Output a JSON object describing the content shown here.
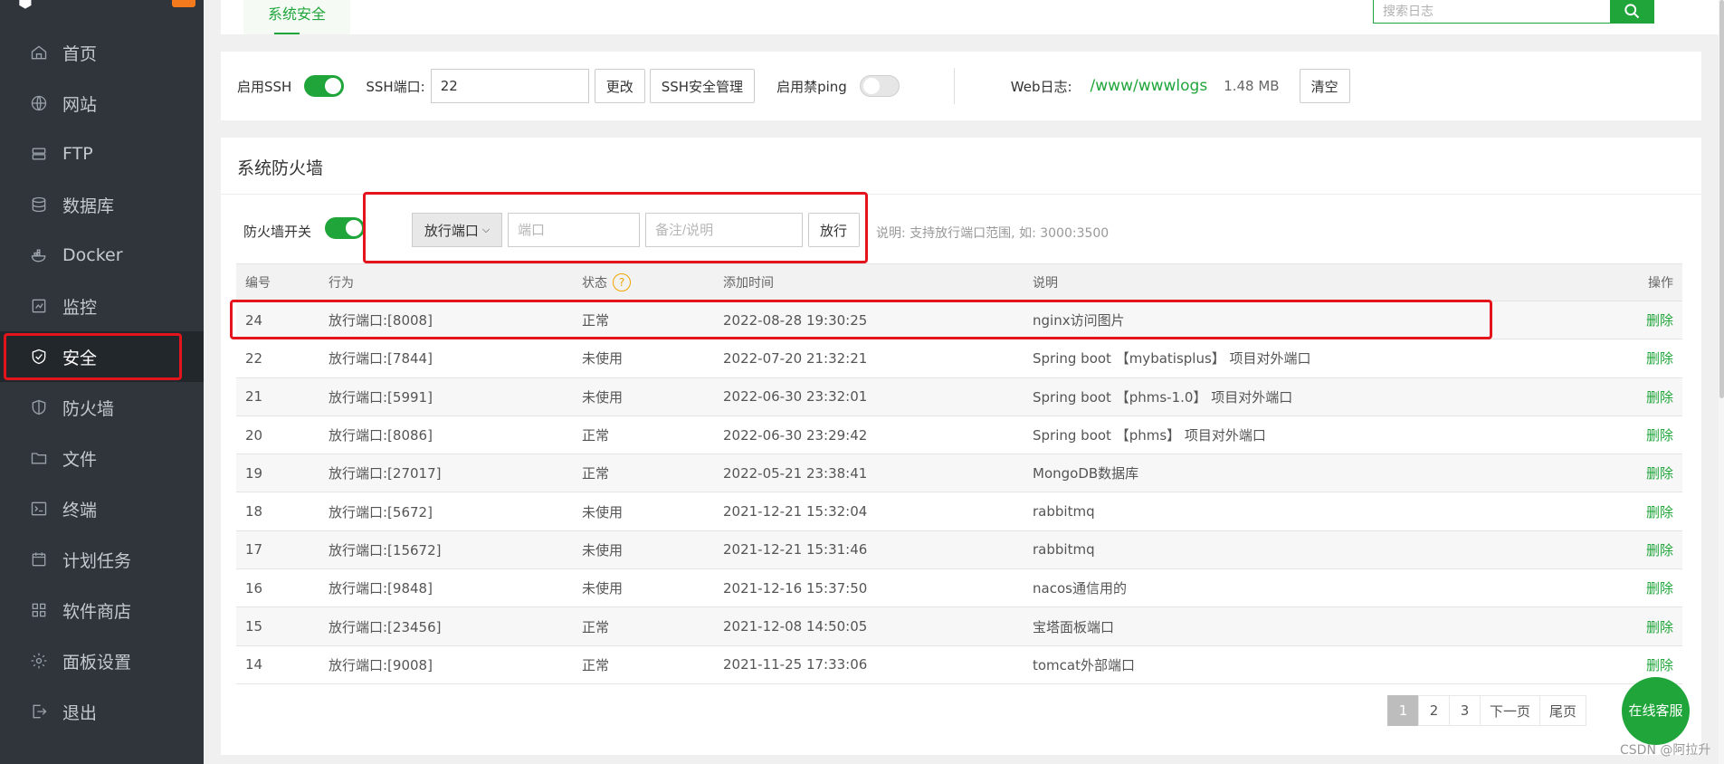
{
  "sidebar": {
    "items": [
      {
        "label": "首页",
        "icon": "home-icon"
      },
      {
        "label": "网站",
        "icon": "globe-icon"
      },
      {
        "label": "FTP",
        "icon": "ftp-icon"
      },
      {
        "label": "数据库",
        "icon": "database-icon"
      },
      {
        "label": "Docker",
        "icon": "docker-icon"
      },
      {
        "label": "监控",
        "icon": "monitor-icon"
      },
      {
        "label": "安全",
        "icon": "shield-check-icon",
        "active": true
      },
      {
        "label": "防火墙",
        "icon": "shield-icon"
      },
      {
        "label": "文件",
        "icon": "folder-icon"
      },
      {
        "label": "终端",
        "icon": "terminal-icon"
      },
      {
        "label": "计划任务",
        "icon": "calendar-icon"
      },
      {
        "label": "软件商店",
        "icon": "apps-icon"
      },
      {
        "label": "面板设置",
        "icon": "gear-icon"
      },
      {
        "label": "退出",
        "icon": "logout-icon"
      }
    ]
  },
  "tabs": {
    "active": "系统安全"
  },
  "log_search": {
    "placeholder": "搜索日志"
  },
  "ssh": {
    "enable_label": "启用SSH",
    "enabled": true,
    "port_label": "SSH端口:",
    "port_value": "22",
    "change_button": "更改",
    "manage_button": "SSH安全管理",
    "ping_label": "启用禁ping",
    "ping_enabled": false,
    "weblog_label": "Web日志:",
    "weblog_path": "/www/wwwlogs",
    "weblog_size": "1.48 MB",
    "clear_button": "清空"
  },
  "firewall": {
    "title": "系统防火墙",
    "switch_label": "防火墙开关",
    "switch_on": true,
    "select_value": "放行端口",
    "port_placeholder": "端口",
    "note_placeholder": "备注/说明",
    "allow_button": "放行",
    "hint": "说明: 支持放行端口范围, 如: 3000:3500",
    "columns": {
      "id": "编号",
      "action": "行为",
      "status": "状态",
      "time": "添加时间",
      "desc": "说明",
      "op": "操作"
    },
    "rows": [
      {
        "id": "24",
        "action": "放行端口:[8008]",
        "status": "正常",
        "time": "2022-08-28 19:30:25",
        "desc": "nginx访问图片",
        "op": "删除"
      },
      {
        "id": "22",
        "action": "放行端口:[7844]",
        "status": "未使用",
        "time": "2022-07-20 21:32:21",
        "desc": "Spring boot 【mybatisplus】 项目对外端口",
        "op": "删除"
      },
      {
        "id": "21",
        "action": "放行端口:[5991]",
        "status": "未使用",
        "time": "2022-06-30 23:32:01",
        "desc": "Spring boot 【phms-1.0】 项目对外端口",
        "op": "删除"
      },
      {
        "id": "20",
        "action": "放行端口:[8086]",
        "status": "正常",
        "time": "2022-06-30 23:29:42",
        "desc": "Spring boot 【phms】 项目对外端口",
        "op": "删除"
      },
      {
        "id": "19",
        "action": "放行端口:[27017]",
        "status": "正常",
        "time": "2022-05-21 23:38:41",
        "desc": "MongoDB数据库",
        "op": "删除"
      },
      {
        "id": "18",
        "action": "放行端口:[5672]",
        "status": "未使用",
        "time": "2021-12-21 15:32:04",
        "desc": "rabbitmq",
        "op": "删除"
      },
      {
        "id": "17",
        "action": "放行端口:[15672]",
        "status": "未使用",
        "time": "2021-12-21 15:31:46",
        "desc": "rabbitmq",
        "op": "删除"
      },
      {
        "id": "16",
        "action": "放行端口:[9848]",
        "status": "未使用",
        "time": "2021-12-16 15:37:50",
        "desc": "nacos通信用的",
        "op": "删除"
      },
      {
        "id": "15",
        "action": "放行端口:[23456]",
        "status": "正常",
        "time": "2021-12-08 14:50:05",
        "desc": "宝塔面板端口",
        "op": "删除"
      },
      {
        "id": "14",
        "action": "放行端口:[9008]",
        "status": "正常",
        "time": "2021-11-25 17:33:06",
        "desc": "tomcat外部端口",
        "op": "删除"
      }
    ]
  },
  "pagination": {
    "pages": [
      "1",
      "2",
      "3"
    ],
    "current": "1",
    "next": "下一页",
    "last": "尾页"
  },
  "chat": {
    "label": "在线客服"
  },
  "watermark": "CSDN @阿拉升",
  "colors": {
    "accent": "#20a53a",
    "highlight": "#e3141c",
    "sidebar_bg": "#2f353b"
  }
}
